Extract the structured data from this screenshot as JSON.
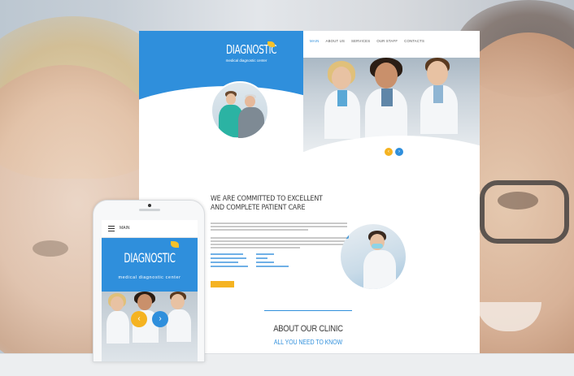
{
  "desktop": {
    "logo": {
      "title": "DIAGNOSTIC",
      "subtitle": "medical diagnostic center"
    },
    "nav": [
      {
        "label": "MAIN",
        "active": true
      },
      {
        "label": "ABOUT US",
        "active": false
      },
      {
        "label": "SERVICES",
        "active": false
      },
      {
        "label": "OUR STAFF",
        "active": false
      },
      {
        "label": "CONTACTS",
        "active": false
      }
    ],
    "slider": {
      "prev_icon": "chevron-left-icon",
      "next_icon": "chevron-right-icon"
    },
    "commitment": {
      "heading_line1": "WE ARE COMMITTED TO EXCELLENT",
      "heading_line2": "AND COMPLETE PATIENT CARE"
    },
    "about": {
      "title": "ABOUT OUR CLINIC",
      "subtitle": "ALL YOU NEED TO KNOW"
    }
  },
  "phone": {
    "menu_icon": "hamburger-menu-icon",
    "menu_label": "MAIN",
    "logo": {
      "title": "DIAGNOSTIC",
      "subtitle": "medical diagnostic center"
    },
    "slider": {
      "prev_icon": "chevron-left-icon",
      "next_icon": "chevron-right-icon"
    }
  },
  "colors": {
    "brand_blue": "#2f8fdc",
    "accent_yellow": "#f5b321",
    "leaf_yellow": "#f5c12a"
  }
}
